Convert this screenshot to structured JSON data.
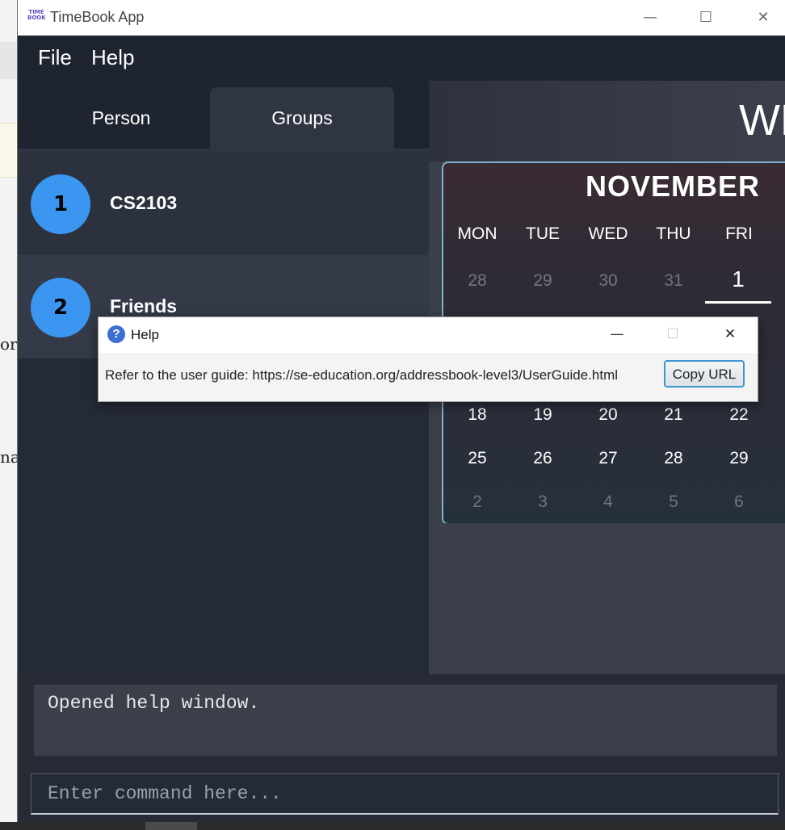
{
  "background": {
    "fragments": [
      "or",
      "nat"
    ]
  },
  "window": {
    "title": "TimeBook App",
    "logo_lines": [
      "TIME",
      "BOOK"
    ],
    "controls": {
      "minimize": "—",
      "maximize": "☐",
      "close": "✕"
    }
  },
  "menu": {
    "file": "File",
    "help": "Help"
  },
  "tabs": [
    {
      "label": "Person",
      "active": false
    },
    {
      "label": "Groups",
      "active": true
    }
  ],
  "groups": [
    {
      "index": "1",
      "name": "CS2103"
    },
    {
      "index": "2",
      "name": "Friends"
    }
  ],
  "right_panel": {
    "heading_partial": "WE"
  },
  "calendar": {
    "month": "NOVEMBER",
    "days_of_week": [
      "MON",
      "TUE",
      "WED",
      "THU",
      "FRI"
    ],
    "rows": [
      [
        "28",
        "29",
        "30",
        "31",
        "1"
      ],
      [
        "18",
        "19",
        "20",
        "21",
        "22"
      ],
      [
        "25",
        "26",
        "27",
        "28",
        "29"
      ],
      [
        "2",
        "3",
        "4",
        "5",
        "6"
      ]
    ],
    "today": "1"
  },
  "result_display": {
    "text": "Opened help window."
  },
  "command_box": {
    "placeholder": "Enter command here..."
  },
  "help_dialog": {
    "title": "Help",
    "icon": "?",
    "message": "Refer to the user guide: https://se-education.org/addressbook-level3/UserGuide.html",
    "copy_button": "Copy URL",
    "controls": {
      "minimize": "—",
      "maximize": "☐",
      "close": "✕"
    }
  },
  "colors": {
    "accent_blue": "#3a96f0",
    "app_background": "#262b36",
    "dialog_button_border": "#3e96cf"
  }
}
